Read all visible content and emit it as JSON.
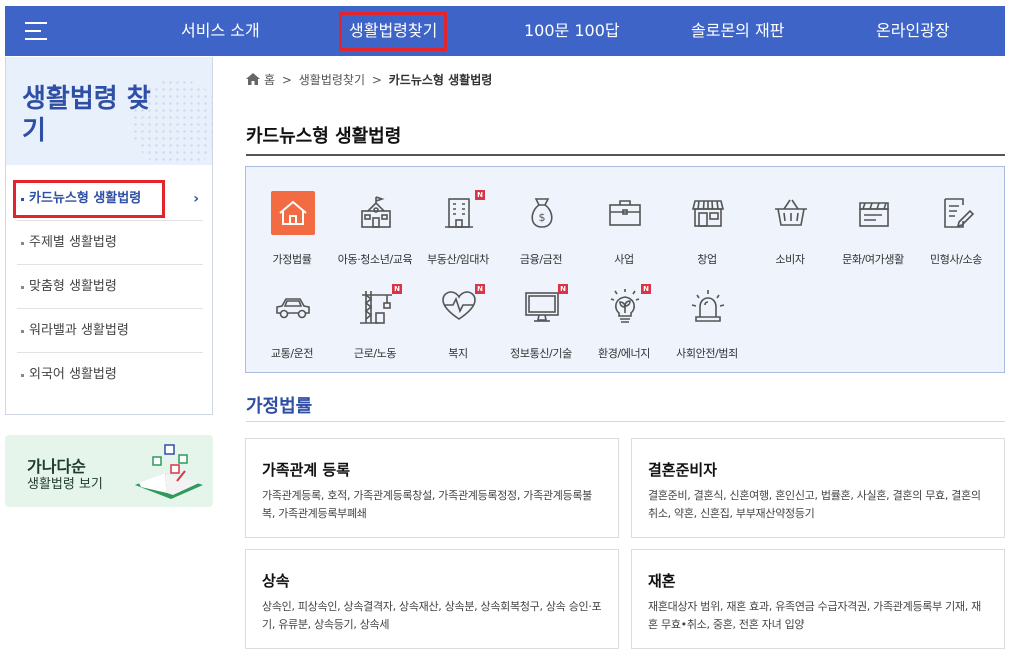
{
  "nav": {
    "items": [
      {
        "label": "서비스 소개"
      },
      {
        "label": "생활법령찾기"
      },
      {
        "label": "100문 100답"
      },
      {
        "label": "솔로몬의 재판"
      },
      {
        "label": "온라인광장"
      }
    ],
    "active_index": 1
  },
  "sidebar": {
    "title": "생활법령 찾기",
    "items": [
      {
        "label": "카드뉴스형 생활법령",
        "chevron": "›"
      },
      {
        "label": "주제별 생활법령"
      },
      {
        "label": "맞춤형 생활법령"
      },
      {
        "label": "워라밸과 생활법령"
      },
      {
        "label": "외국어 생활법령"
      }
    ],
    "banner": {
      "title": "가나다순",
      "subtitle": "생활법령 보기"
    }
  },
  "breadcrumb": {
    "items": [
      "홈",
      "생활법령찾기",
      "카드뉴스형 생활법령"
    ],
    "separator": ">"
  },
  "page_title": "카드뉴스형 생활법령",
  "badge_text": "N",
  "categories": [
    {
      "label": "가정법률",
      "icon": "house-icon",
      "active": true
    },
    {
      "label": "아동·청소년/교육",
      "icon": "school-icon"
    },
    {
      "label": "부동산/임대차",
      "icon": "building-icon",
      "new": true
    },
    {
      "label": "금융/금전",
      "icon": "money-bag-icon"
    },
    {
      "label": "사업",
      "icon": "briefcase-icon"
    },
    {
      "label": "창업",
      "icon": "storefront-icon"
    },
    {
      "label": "소비자",
      "icon": "shopping-basket-icon"
    },
    {
      "label": "문화/여가생활",
      "icon": "clapperboard-icon"
    },
    {
      "label": "민형사/소송",
      "icon": "document-pen-icon"
    },
    {
      "label": "교통/운전",
      "icon": "car-icon"
    },
    {
      "label": "근로/노동",
      "icon": "crane-icon",
      "new": true
    },
    {
      "label": "복지",
      "icon": "heart-pulse-icon",
      "new": true
    },
    {
      "label": "정보통신/기술",
      "icon": "monitor-icon",
      "new": true
    },
    {
      "label": "환경/에너지",
      "icon": "eco-bulb-icon",
      "new": true
    },
    {
      "label": "사회안전/범죄",
      "icon": "siren-icon"
    }
  ],
  "section_title": "가정법률",
  "cards": [
    {
      "title": "가족관계 등록",
      "desc": "가족관계등록, 호적, 가족관계등록창설, 가족관계등록정정, 가족관계등록불복, 가족관계등록부폐쇄"
    },
    {
      "title": "결혼준비자",
      "desc": "결혼준비, 결혼식, 신혼여행, 혼인신고, 법률혼, 사실혼, 결혼의 무효, 결혼의 취소, 약혼, 신혼집, 부부재산약정등기"
    },
    {
      "title": "상속",
      "desc": "상속인, 피상속인, 상속결격자, 상속재산, 상속분, 상속회복청구, 상속 승인·포기, 유류분, 상속등기, 상속세"
    },
    {
      "title": "재혼",
      "desc": "재혼대상자 범위, 재혼 효과, 유족연금 수급자격권, 가족관계등록부 기재, 재혼 무효•취소, 중혼, 전혼 자녀 입양"
    }
  ],
  "colors": {
    "nav_bg": "#3d64c6",
    "accent": "#2f4fa6",
    "highlight_box": "#e3242b",
    "active_icon_bg": "#f26b43",
    "badge": "#d93448"
  }
}
